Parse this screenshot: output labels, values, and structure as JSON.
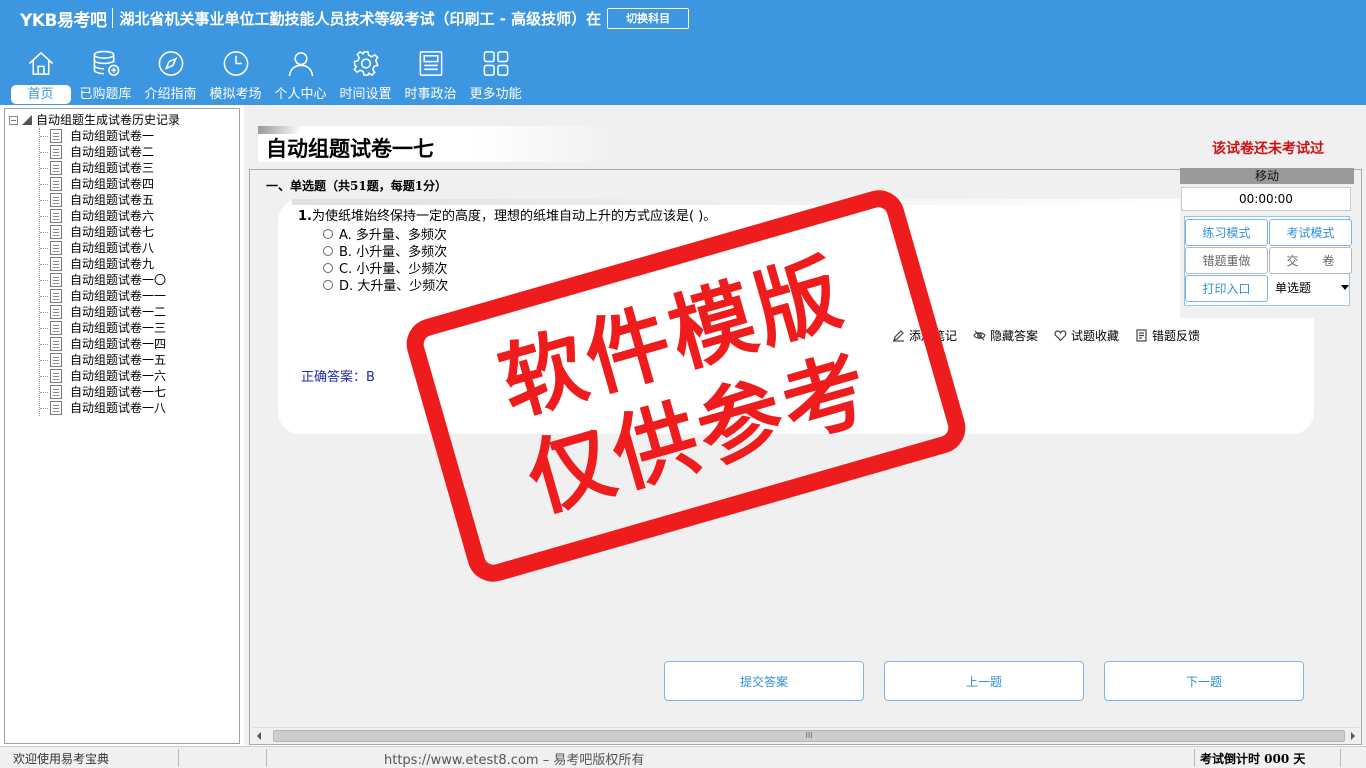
{
  "header": {
    "logo": "YKB易考吧",
    "title": "湖北省机关事业单位工勤技能人员技术等级考试（印刷工 - 高级技师）在",
    "switch_button": "切换科目",
    "background_color": "#3d96e0"
  },
  "nav": {
    "items": [
      {
        "label": "首页",
        "icon": "home-icon",
        "active": true
      },
      {
        "label": "已购题库",
        "icon": "database-icon"
      },
      {
        "label": "介绍指南",
        "icon": "compass-icon"
      },
      {
        "label": "模拟考场",
        "icon": "clock-icon"
      },
      {
        "label": "个人中心",
        "icon": "user-icon"
      },
      {
        "label": "时间设置",
        "icon": "gear-icon"
      },
      {
        "label": "时事政治",
        "icon": "news-icon"
      },
      {
        "label": "更多功能",
        "icon": "grid-icon"
      }
    ]
  },
  "tree": {
    "root_label": "自动组题生成试卷历史记录",
    "toggle": "−",
    "items": [
      "自动组题试卷一",
      "自动组题试卷二",
      "自动组题试卷三",
      "自动组题试卷四",
      "自动组题试卷五",
      "自动组题试卷六",
      "自动组题试卷七",
      "自动组题试卷八",
      "自动组题试卷九",
      "自动组题试卷一〇",
      "自动组题试卷一一",
      "自动组题试卷一二",
      "自动组题试卷一三",
      "自动组题试卷一四",
      "自动组题试卷一五",
      "自动组题试卷一六",
      "自动组题试卷一七",
      "自动组题试卷一八"
    ]
  },
  "paper": {
    "title": "自动组题试卷一七",
    "status": "该试卷还未考试过",
    "section_title": "一、单选题（共51题，每题1分）"
  },
  "question": {
    "number": "1.",
    "text": "为使纸堆始终保持一定的高度，理想的纸堆自动上升的方式应该是(  )。",
    "options": [
      "A. 多升量、多频次",
      "B. 小升量、多频次",
      "C. 小升量、少频次",
      "D. 大升量、少频次"
    ],
    "tools": {
      "add_note": "添加笔记",
      "hide_answer": "隐藏答案",
      "favorite": "试题收藏",
      "report_error": "错题反馈"
    },
    "answer_label": "正确答案：",
    "answer_value": "B"
  },
  "control": {
    "move": "移动",
    "timer": "00:00:00",
    "practice_mode": "练习模式",
    "exam_mode": "考试模式",
    "redo_wrong": "错题重做",
    "submit_paper": "交　　卷",
    "print": "打印入口",
    "question_type": "单选题"
  },
  "bottom_buttons": {
    "submit": "提交答案",
    "prev": "上一题",
    "next": "下一题"
  },
  "scrollbar": {
    "grip": "III"
  },
  "status": {
    "welcome": "欢迎使用易考宝典",
    "url": "https://www.etest8.com – 易考吧版权所有",
    "countdown": "考试倒计时 000 天"
  },
  "watermark": {
    "line1": "软件模版",
    "line2": "仅供参考",
    "color": "#ee1c1c"
  }
}
